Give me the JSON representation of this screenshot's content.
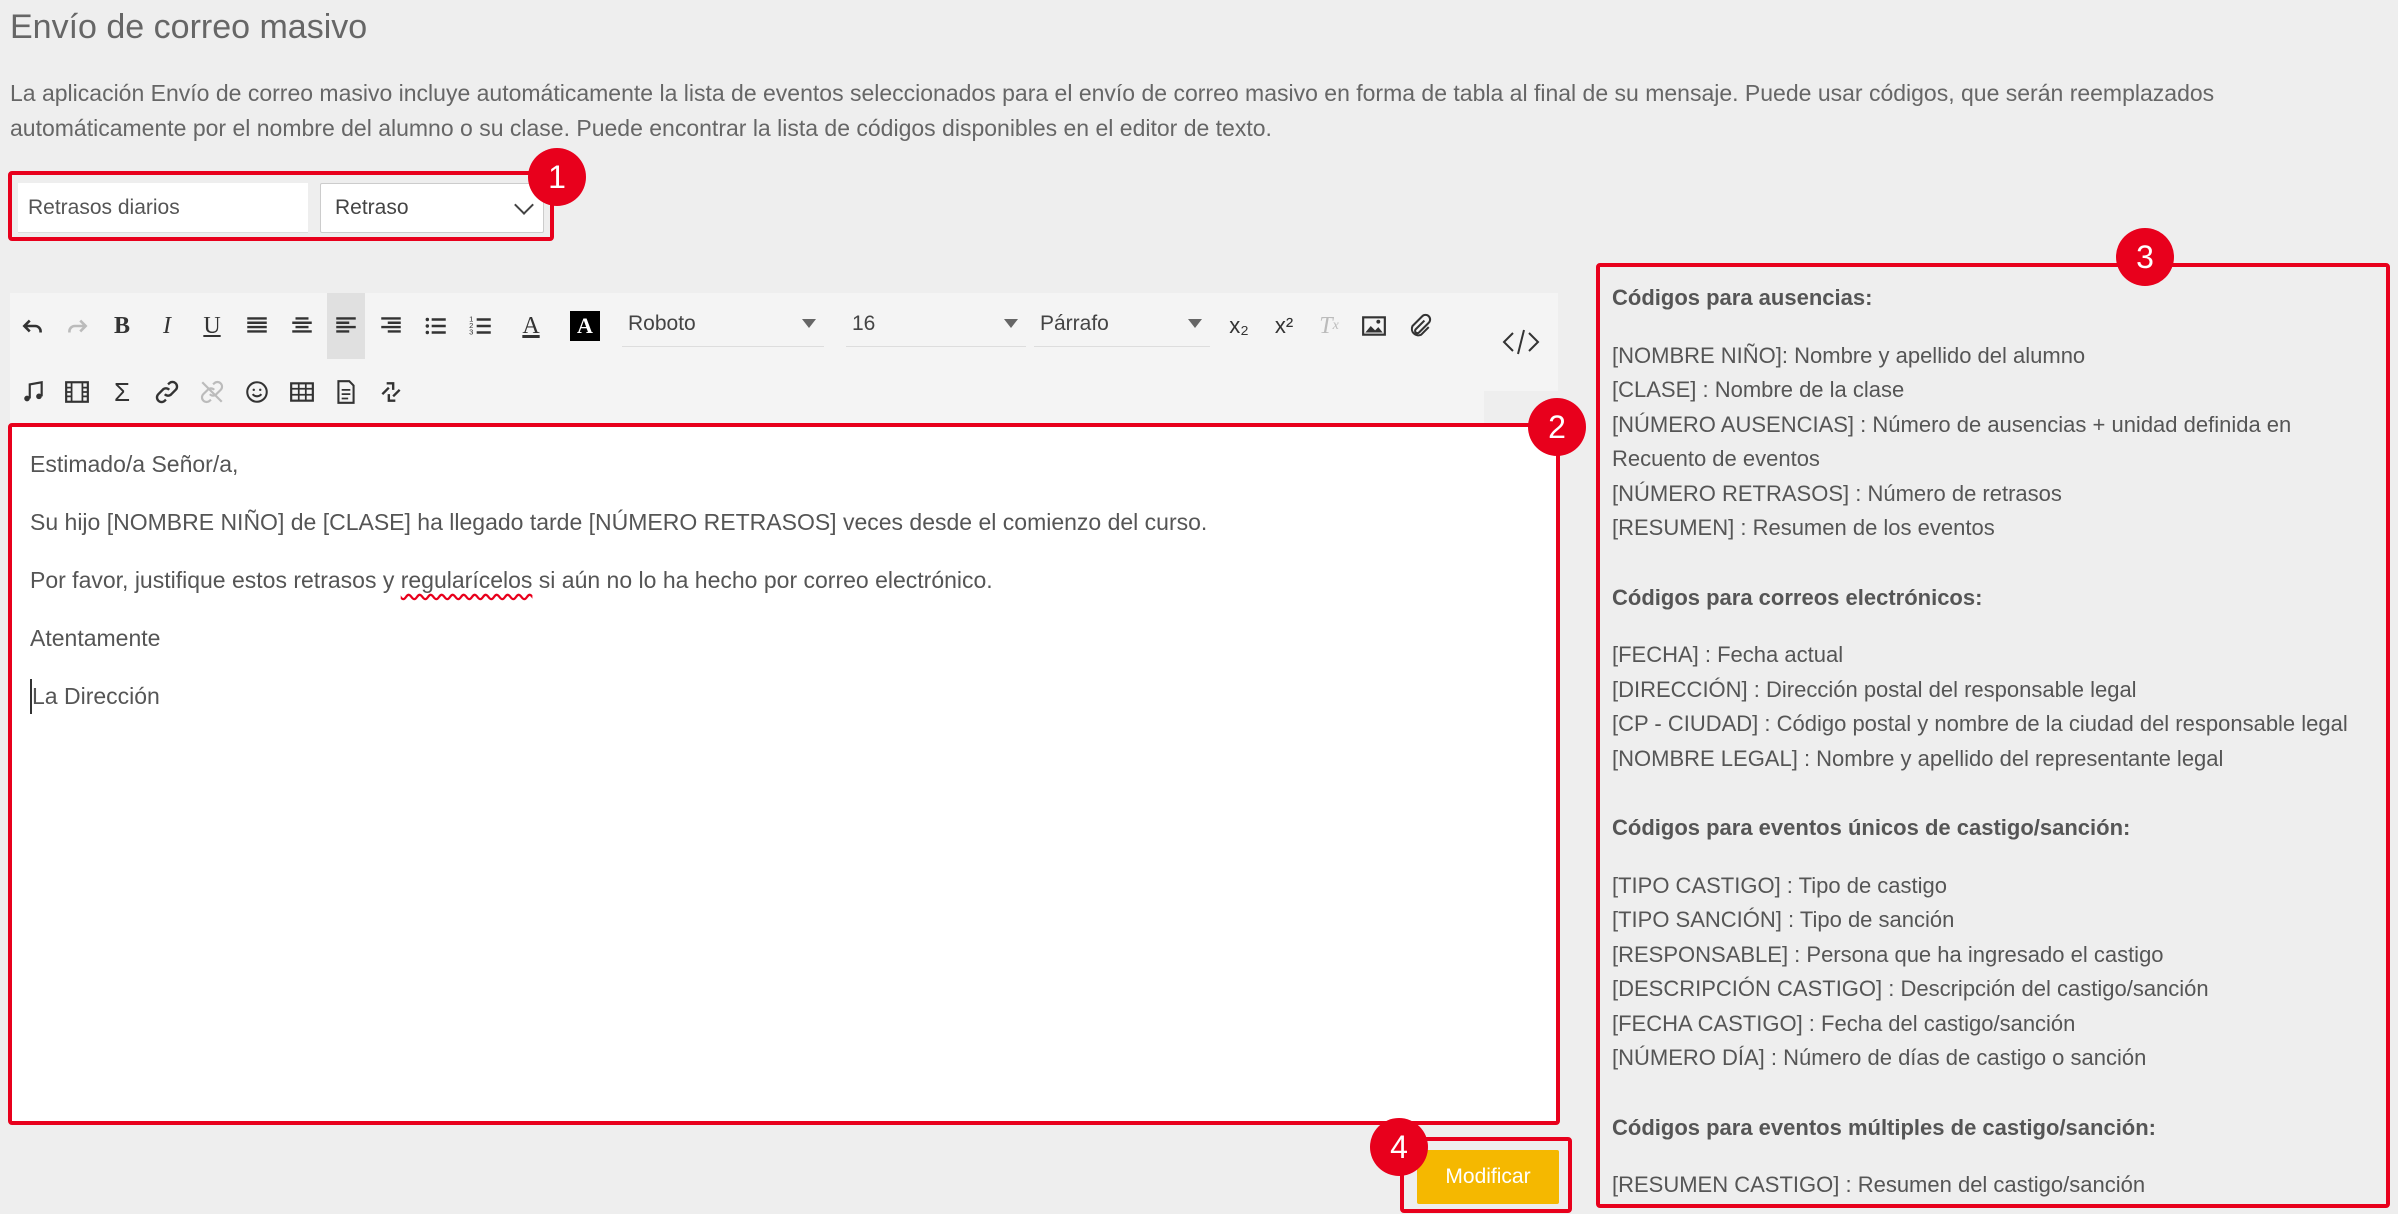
{
  "page": {
    "title": "Envío de correo masivo",
    "intro": "La aplicación Envío de correo masivo incluye automáticamente la lista de eventos seleccionados para el envío de correo masivo en forma de tabla al final de su mensaje. Puede usar códigos, que serán reemplazados automáticamente por el nombre del alumno o su clase. Puede encontrar la lista de códigos disponibles en el editor de texto."
  },
  "form": {
    "name_value": "Retrasos diarios",
    "type_value": "Retraso"
  },
  "toolbar": {
    "font_family": "Roboto",
    "font_size": "16",
    "paragraph_format": "Párrafo",
    "subscript_label": "x₂",
    "superscript_label": "x²"
  },
  "editor": {
    "greeting": "Estimado/a Señor/a,",
    "line1": "Su hijo [NOMBRE NIÑO] de [CLASE] ha llegado tarde [NÚMERO RETRASOS] veces desde el comienzo del curso.",
    "line2_before": "Por favor, justifique estos retrasos y ",
    "line2_misspelled": "regularícelos",
    "line2_after": " si aún no lo ha hecho por correo electrónico.",
    "closing": "Atentamente",
    "signature": "La Dirección"
  },
  "codes": {
    "absences": {
      "heading": "Códigos para ausencias:",
      "lines": [
        "[NOMBRE NIÑO]: Nombre y apellido del alumno",
        "[CLASE] : Nombre de la clase",
        "[NÚMERO AUSENCIAS] : Número de ausencias + unidad definida en Recuento de eventos",
        "[NÚMERO RETRASOS] : Número de retrasos",
        "[RESUMEN] : Resumen de los eventos"
      ]
    },
    "emails": {
      "heading": "Códigos para correos electrónicos:",
      "lines": [
        "[FECHA] : Fecha actual",
        "[DIRECCIÓN] : Dirección postal del responsable legal",
        "[CP - CIUDAD] : Código postal y nombre de la ciudad del responsable legal",
        "[NOMBRE LEGAL] : Nombre y apellido del representante legal"
      ]
    },
    "single_punishment": {
      "heading": "Códigos para eventos únicos de castigo/sanción:",
      "lines": [
        "[TIPO CASTIGO] : Tipo de castigo",
        "[TIPO SANCIÓN] : Tipo de sanción",
        "[RESPONSABLE] : Persona que ha ingresado el castigo",
        "[DESCRIPCIÓN CASTIGO] : Descripción del castigo/sanción",
        "[FECHA CASTIGO] : Fecha del castigo/sanción",
        "[NÚMERO DÍA] : Número de días de castigo o sanción"
      ]
    },
    "multiple_punishment": {
      "heading": "Códigos para eventos múltiples de castigo/sanción:",
      "lines": [
        "[RESUMEN CASTIGO] : Resumen del castigo/sanción"
      ]
    }
  },
  "actions": {
    "modify_label": "Modificar"
  },
  "callouts": {
    "one": "1",
    "two": "2",
    "three": "3",
    "four": "4"
  },
  "colors": {
    "highlight": "#e8001c",
    "button": "#f5b800",
    "background": "#eeeeee"
  }
}
